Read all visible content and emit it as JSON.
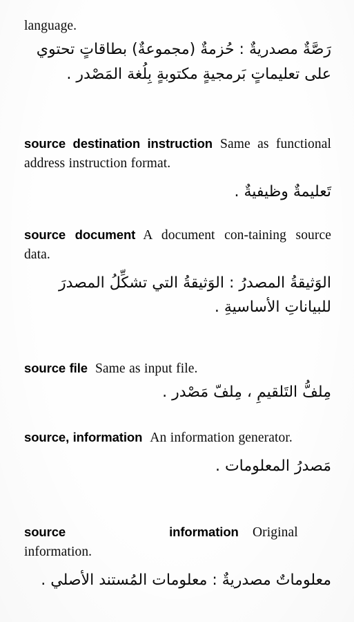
{
  "document": {
    "type": "scanned-dictionary-page",
    "language_pair": "English-Arabic",
    "background_color": "#fefefe",
    "text_color": "#0b0b0b"
  },
  "continuation": {
    "english_tail": "language.",
    "arabic_lines": [
      "رَصَّةٌ مصدريةٌ : حُزمةٌ (مجموعةٌ) بطاقاتٍ تحتوي",
      "على تعليماتٍ بَرمجيةٍ مكتوبةٍ بِلُغة المَصْدر ."
    ]
  },
  "entries": [
    {
      "id": "source-destination-instruction",
      "headword": "source destination instruction",
      "headword_parts": [
        "source destination instruction"
      ],
      "definition": "Same as functional address instruction format.",
      "arabic_lines": [
        "تَعليمةٌ وظيفيةٌ ."
      ],
      "arabic_align": "right"
    },
    {
      "id": "source-document",
      "headword": "source document",
      "headword_parts": [
        "source document"
      ],
      "definition": "A document con-taining source data.",
      "definition_lines": [
        "A document con-",
        "taining source data."
      ],
      "arabic_lines": [
        "الوَثيقةُ المصدرُ : الوَثيقةُ التي تشكِّلُ المصدرَ",
        "للبياناتِ الأساسيةِ ."
      ],
      "arabic_align": "justify"
    },
    {
      "id": "source-file",
      "headword": "source file",
      "headword_parts": [
        "source file"
      ],
      "definition": "Same as input file.",
      "arabic_lines": [
        "مِلفُّ التَلقيمِ ، مِلفّ مَصْدر ."
      ],
      "arabic_align": "right"
    },
    {
      "id": "source-information",
      "headword": "source, information",
      "headword_parts": [
        "source, information"
      ],
      "definition": "An information generator.",
      "definition_lines": [
        "An information",
        "generator."
      ],
      "arabic_lines": [
        "مَصدرُ المعلومات ."
      ],
      "arabic_align": "right"
    },
    {
      "id": "source-information-original",
      "headword": "source information",
      "headword_parts": [
        "source",
        "information"
      ],
      "headword_spread": true,
      "definition": "Original information.",
      "definition_lines": [
        "Original",
        "information."
      ],
      "arabic_lines": [
        "معلوماتٌ مصدريةٌ : معلومات المُستند الأصلي ."
      ],
      "arabic_align": "right"
    }
  ]
}
